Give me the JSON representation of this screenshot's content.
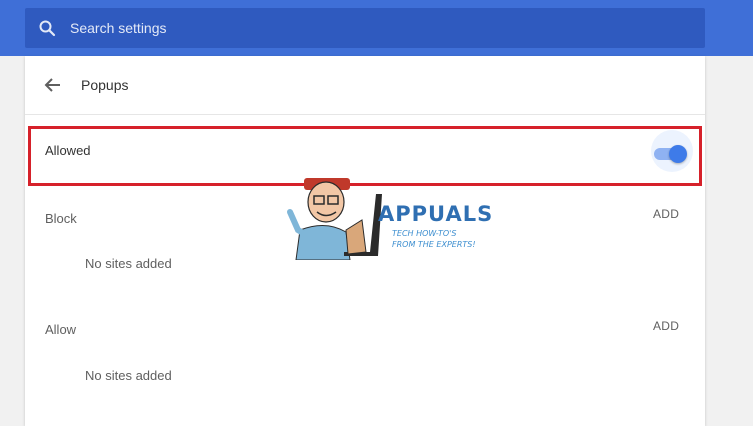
{
  "search": {
    "placeholder": "Search settings",
    "icon": "search-icon"
  },
  "header": {
    "title": "Popups",
    "back_icon": "arrow-back-icon"
  },
  "allowed_row": {
    "label": "Allowed",
    "toggle_on": true
  },
  "sections": [
    {
      "label": "Block",
      "add_label": "ADD",
      "empty_text": "No sites added"
    },
    {
      "label": "Allow",
      "add_label": "ADD",
      "empty_text": "No sites added"
    }
  ],
  "watermark": {
    "brand": "APPUALS",
    "tagline": "TECH HOW-TO'S FROM THE EXPERTS!"
  },
  "colors": {
    "topbar": "#3f6fd7",
    "searchbox": "#2f5abf",
    "toggle_knob": "#3e7be9",
    "toggle_track": "#8fb2f2",
    "highlight": "#d6212a",
    "watermark": "#2f6fb2"
  }
}
